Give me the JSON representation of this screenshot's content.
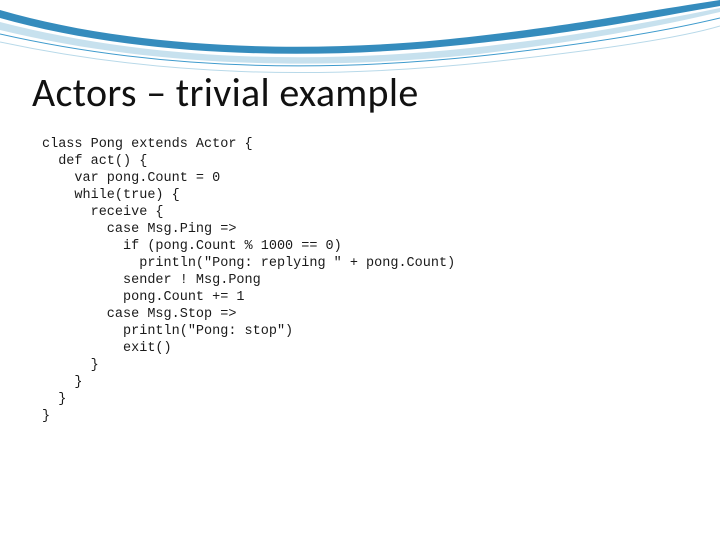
{
  "slide": {
    "title": "Actors – trivial example",
    "code_lines": [
      "class Pong extends Actor {",
      "  def act() {",
      "    var pong.Count = 0",
      "    while(true) {",
      "      receive {",
      "        case Msg.Ping =>",
      "          if (pong.Count % 1000 == 0)",
      "            println(\"Pong: replying \" + pong.Count)",
      "          sender ! Msg.Pong",
      "          pong.Count += 1",
      "        case Msg.Stop =>",
      "          println(\"Pong: stop\")",
      "          exit()",
      "      }",
      "    }",
      "  }",
      "}"
    ]
  }
}
